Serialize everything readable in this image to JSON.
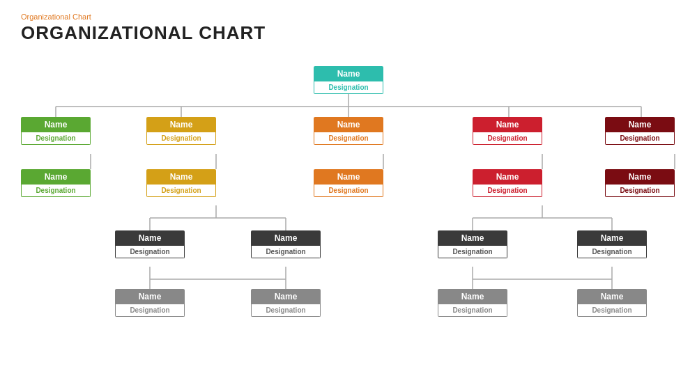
{
  "page": {
    "subtitle": "Organizational  Chart",
    "title": "ORGANIZATIONAL CHART"
  },
  "nodes": {
    "root": {
      "name": "Name",
      "designation": "Designation"
    },
    "l1": [
      {
        "name": "Name",
        "designation": "Designation",
        "color": "green"
      },
      {
        "name": "Name",
        "designation": "Designation",
        "color": "yellow"
      },
      {
        "name": "Name",
        "designation": "Designation",
        "color": "orange"
      },
      {
        "name": "Name",
        "designation": "Designation",
        "color": "red"
      },
      {
        "name": "Name",
        "designation": "Designation",
        "color": "darkred"
      }
    ],
    "l2": [
      {
        "name": "Name",
        "designation": "Designation",
        "color": "green"
      },
      {
        "name": "Name",
        "designation": "Designation",
        "color": "yellow"
      },
      {
        "name": "Name",
        "designation": "Designation",
        "color": "orange"
      },
      {
        "name": "Name",
        "designation": "Designation",
        "color": "red"
      },
      {
        "name": "Name",
        "designation": "Designation",
        "color": "darkred"
      }
    ],
    "l3": [
      {
        "name": "Name",
        "designation": "Designation",
        "color": "darkgray"
      },
      {
        "name": "Name",
        "designation": "Designation",
        "color": "darkgray"
      },
      {
        "name": "Name",
        "designation": "Designation",
        "color": "darkgray"
      },
      {
        "name": "Name",
        "designation": "Designation",
        "color": "darkgray"
      }
    ],
    "l4": [
      {
        "name": "Name",
        "designation": "Designation",
        "color": "gray"
      },
      {
        "name": "Name",
        "designation": "Designation",
        "color": "gray"
      },
      {
        "name": "Name",
        "designation": "Designation",
        "color": "gray"
      },
      {
        "name": "Name",
        "designation": "Designation",
        "color": "gray"
      }
    ]
  }
}
